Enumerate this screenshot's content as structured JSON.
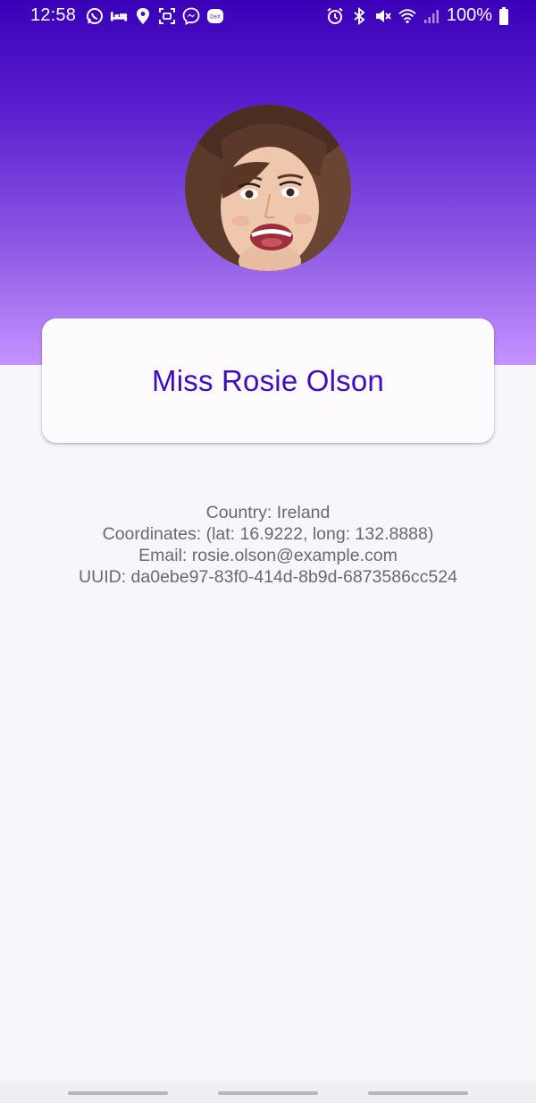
{
  "status_bar": {
    "time": "12:58",
    "battery": "100%",
    "left_icons": [
      "whatsapp-icon",
      "bed-icon",
      "location-pin-icon",
      "screen-record-icon",
      "messenger-icon",
      "dex-icon"
    ],
    "right_icons": [
      "alarm-icon",
      "bluetooth-icon",
      "mute-icon",
      "wifi-icon",
      "signal-icon",
      "battery-icon"
    ],
    "dex_label": "DeX"
  },
  "profile": {
    "name": "Miss Rosie Olson",
    "avatar_alt": "avatar"
  },
  "details": {
    "country": "Country: Ireland",
    "coordinates": "Coordinates: (lat: 16.9222, long: 132.8888)",
    "email": "Email: rosie.olson@example.com",
    "uuid": "UUID: da0ebe97-83f0-414d-8b9d-6873586cc524"
  },
  "colors": {
    "header_top": "#3a00b8",
    "header_bottom": "#c493ff",
    "name_color": "#3f0dbe",
    "background": "#f8f6fb",
    "detail_text": "#6a6a6a"
  },
  "navigation": {
    "handles": [
      "recent-apps-handle",
      "home-handle",
      "back-handle"
    ]
  }
}
